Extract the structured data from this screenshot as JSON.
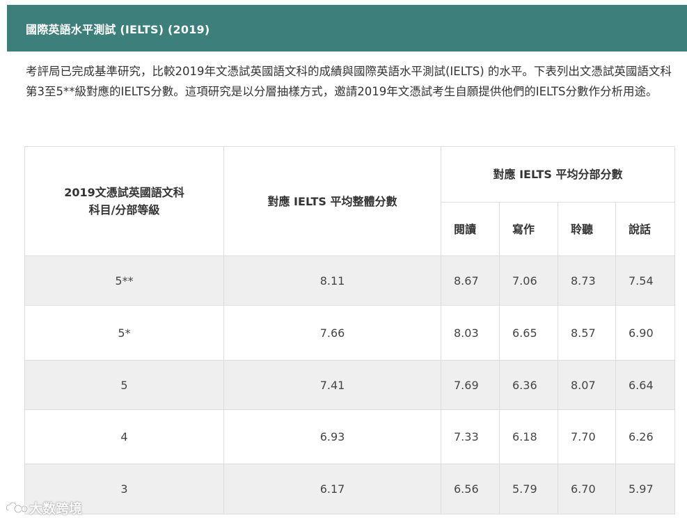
{
  "header": {
    "title": "國際英語水平測試 (IELTS) (2019)"
  },
  "intro": {
    "text": "考評局已完成基準研究，比較2019年文憑試英國語文科的成績與國際英語水平測試(IELTS) 的水平。下表列出文憑試英國語文科第3至5**級對應的IELTS分數。這項研究是以分層抽樣方式，邀請2019年文憑試考生自願提供他們的IELTS分數作分析用途。"
  },
  "table": {
    "headers": {
      "level_line1": "2019文憑試英國語文科",
      "level_line2": "科目/分部等級",
      "overall": "對應 IELTS 平均整體分數",
      "components_group": "對應 IELTS 平均分部分數",
      "reading": "閱讀",
      "writing": "寫作",
      "listening": "聆聽",
      "speaking": "說話"
    },
    "rows": [
      {
        "level": "5**",
        "overall": "8.11",
        "reading": "8.67",
        "writing": "7.06",
        "listening": "8.73",
        "speaking": "7.54"
      },
      {
        "level": "5*",
        "overall": "7.66",
        "reading": "8.03",
        "writing": "6.65",
        "listening": "8.57",
        "speaking": "6.90"
      },
      {
        "level": "5",
        "overall": "7.41",
        "reading": "7.69",
        "writing": "6.36",
        "listening": "8.07",
        "speaking": "6.64"
      },
      {
        "level": "4",
        "overall": "6.93",
        "reading": "7.33",
        "writing": "6.18",
        "listening": "7.70",
        "speaking": "6.26"
      },
      {
        "level": "3",
        "overall": "6.17",
        "reading": "6.56",
        "writing": "5.79",
        "listening": "6.70",
        "speaking": "5.97"
      }
    ]
  },
  "watermark": {
    "text": "大数跨境",
    "icon": "watermark-logo-icon"
  }
}
